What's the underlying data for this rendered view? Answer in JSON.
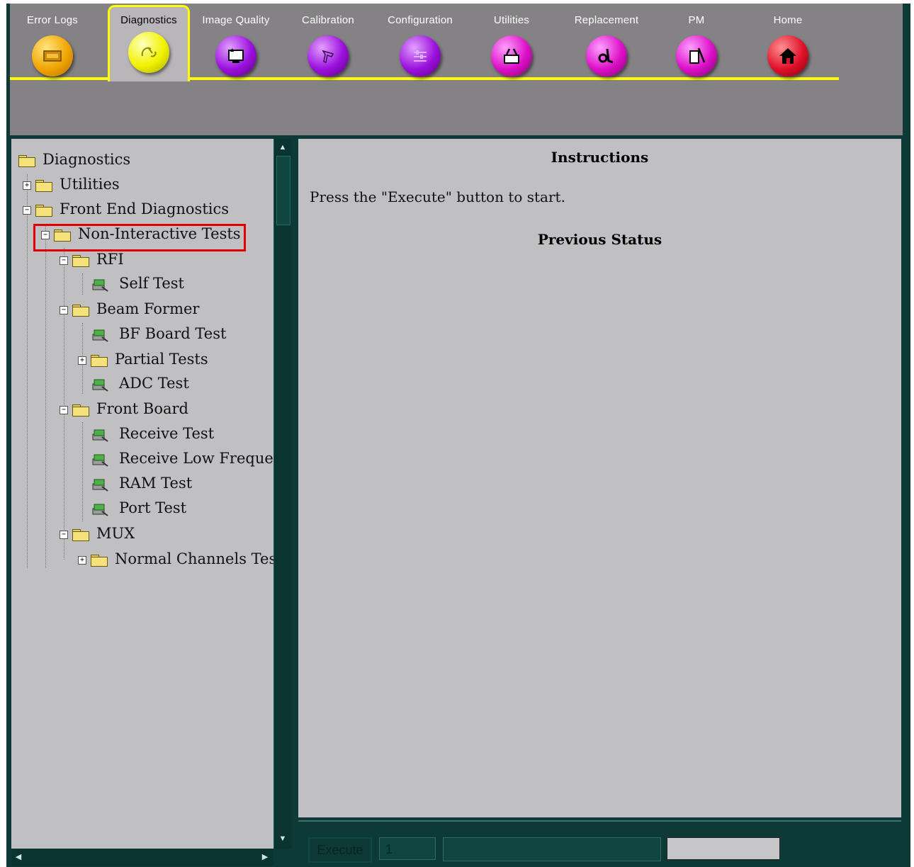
{
  "tabs": [
    {
      "label": "Error Logs",
      "icon": "error-log-icon",
      "color": "orange",
      "active": false
    },
    {
      "label": "Diagnostics",
      "icon": "diagnostics-icon",
      "color": "yellow",
      "active": true
    },
    {
      "label": "Image Quality",
      "icon": "image-quality-icon",
      "color": "purple",
      "active": false
    },
    {
      "label": "Calibration",
      "icon": "calibration-icon",
      "color": "purple",
      "active": false
    },
    {
      "label": "Configuration",
      "icon": "configuration-icon",
      "color": "purple",
      "active": false
    },
    {
      "label": "Utilities",
      "icon": "utilities-icon",
      "color": "magenta",
      "active": false
    },
    {
      "label": "Replacement",
      "icon": "replacement-icon",
      "color": "magenta",
      "active": false
    },
    {
      "label": "PM",
      "icon": "pm-icon",
      "color": "magenta",
      "active": false
    },
    {
      "label": "Home",
      "icon": "home-icon",
      "color": "red",
      "active": false
    }
  ],
  "tree": {
    "nodes": [
      {
        "label": "Diagnostics",
        "kind": "folder-open",
        "expander": ""
      },
      {
        "label": "Utilities",
        "kind": "folder",
        "expander": "+"
      },
      {
        "label": "Front End Diagnostics",
        "kind": "folder-open",
        "expander": "−"
      },
      {
        "label": "Non-Interactive Tests",
        "kind": "folder-open",
        "expander": "−",
        "highlighted": true
      },
      {
        "label": "RFI",
        "kind": "folder-open",
        "expander": "−"
      },
      {
        "label": "Self Test",
        "kind": "test",
        "expander": ""
      },
      {
        "label": "Beam Former",
        "kind": "folder-open",
        "expander": "−"
      },
      {
        "label": "BF Board Test",
        "kind": "test",
        "expander": ""
      },
      {
        "label": "Partial Tests",
        "kind": "folder",
        "expander": "+"
      },
      {
        "label": "ADC Test",
        "kind": "test",
        "expander": ""
      },
      {
        "label": "Front Board",
        "kind": "folder-open",
        "expander": "−"
      },
      {
        "label": "Receive Test",
        "kind": "test",
        "expander": ""
      },
      {
        "label": "Receive Low Frequen",
        "kind": "test",
        "expander": ""
      },
      {
        "label": "RAM Test",
        "kind": "test",
        "expander": ""
      },
      {
        "label": "Port Test",
        "kind": "test",
        "expander": ""
      },
      {
        "label": "MUX",
        "kind": "folder-open",
        "expander": "−"
      },
      {
        "label": "Normal Channels Test",
        "kind": "folder",
        "expander": "+"
      }
    ]
  },
  "instructions": {
    "title": "Instructions",
    "text": "Press the \"Execute\" button to start.",
    "previous_status_title": "Previous Status"
  },
  "bottom": {
    "execute_label": "Execute",
    "count_value": "1"
  },
  "colors": {
    "accent": "#ffff00",
    "highlight": "#e00000",
    "panel": "#c0bfc2",
    "frame": "#0d3a36",
    "toolbar": "#848284"
  }
}
